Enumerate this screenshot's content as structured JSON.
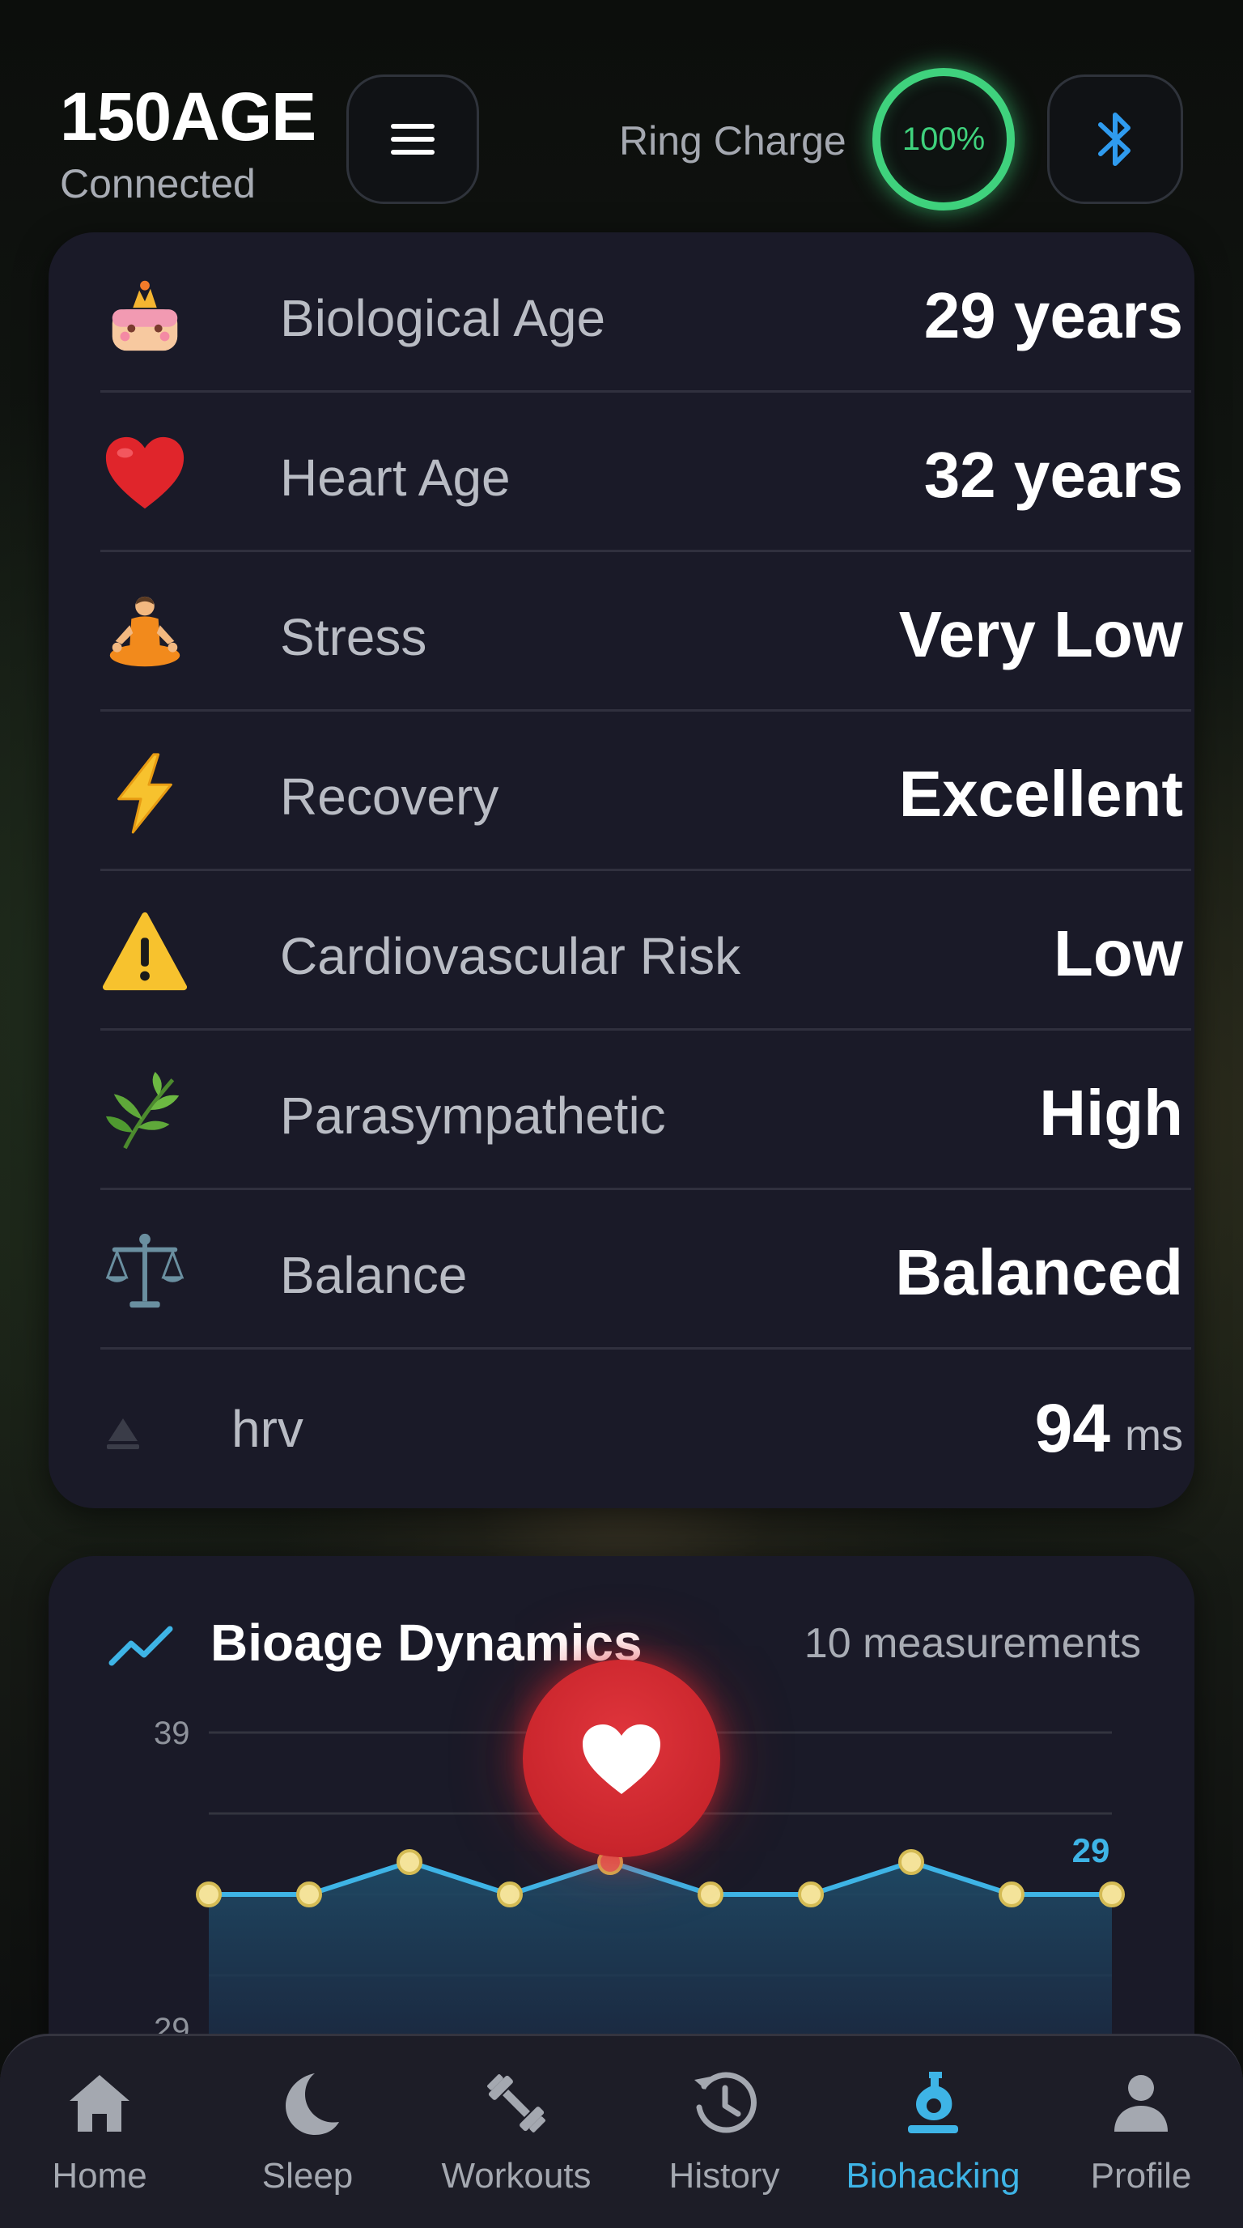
{
  "header": {
    "app_title": "150AGE",
    "status": "Connected",
    "charge_label": "Ring Charge",
    "charge_value": "100%",
    "menu_icon": "hamburger-menu-icon",
    "bluetooth_icon": "bluetooth-icon",
    "charge_color": "#3fd27d"
  },
  "metrics": [
    {
      "icon": "birthday-cake-icon",
      "label": "Biological Age",
      "value": "29 years"
    },
    {
      "icon": "red-heart-icon",
      "label": "Heart Age",
      "value": "32 years"
    },
    {
      "icon": "meditation-icon",
      "label": "Stress",
      "value": "Very Low"
    },
    {
      "icon": "lightning-icon",
      "label": "Recovery",
      "value": "Excellent"
    },
    {
      "icon": "warning-icon",
      "label": "Cardiovascular Risk",
      "value": "Low"
    },
    {
      "icon": "herb-icon",
      "label": "Parasympathetic",
      "value": "High"
    },
    {
      "icon": "balance-scale-icon",
      "label": "Balance",
      "value": "Balanced"
    }
  ],
  "hrv": {
    "label": "hrv",
    "value": "94",
    "unit": "ms",
    "icon": "triangle-up-icon"
  },
  "bioage_chart": {
    "title": "Bioage Dynamics",
    "count": "10 measurements",
    "trend_icon": "trend-line-icon",
    "accent_color": "#3eb4e6"
  },
  "chart_data": {
    "type": "area",
    "x": [
      1,
      2,
      3,
      4,
      5,
      6,
      7,
      8,
      9,
      10
    ],
    "values": [
      29,
      29,
      31,
      29,
      31,
      29,
      29,
      31,
      29,
      29
    ],
    "y_ticks": [
      "39",
      "29"
    ],
    "last_value_label": "29",
    "ylim": [
      24,
      39
    ],
    "grid": true
  },
  "heart_button": {
    "icon": "heart-icon",
    "color": "#d8303a"
  },
  "nav": {
    "items": [
      {
        "label": "Home",
        "icon": "home-icon",
        "active": false
      },
      {
        "label": "Sleep",
        "icon": "moon-icon",
        "active": false
      },
      {
        "label": "Workouts",
        "icon": "dumbbell-icon",
        "active": false
      },
      {
        "label": "History",
        "icon": "history-icon",
        "active": false
      },
      {
        "label": "Biohacking",
        "icon": "flask-icon",
        "active": true
      },
      {
        "label": "Profile",
        "icon": "user-icon",
        "active": false
      }
    ],
    "active_color": "#3eb4e6",
    "inactive_color": "#a4a8b0"
  }
}
